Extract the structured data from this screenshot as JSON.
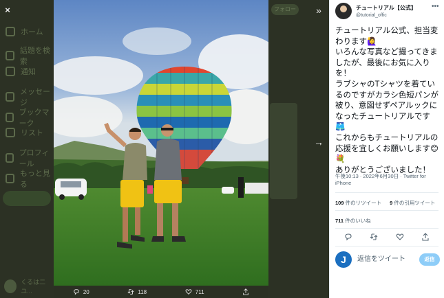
{
  "background": {
    "nav_items": [
      "ホーム",
      "話題を検索",
      "通知",
      "メッセージ",
      "ブックマーク",
      "リスト",
      "プロフィール",
      "もっと見る"
    ],
    "follow_label": "フォロー",
    "profile_name": "くるは二ユ..."
  },
  "viewer": {
    "close_icon": "×",
    "expand_icon": "»",
    "next_icon": "→",
    "photo_actions": [
      {
        "icon": "reply-icon",
        "count": "20"
      },
      {
        "icon": "retweet-icon",
        "count": "118"
      },
      {
        "icon": "like-icon",
        "count": "711"
      },
      {
        "icon": "share-icon",
        "count": ""
      }
    ]
  },
  "tweet": {
    "author_name": "チュートリアル【公式】",
    "author_handle": "@tutorial_offic",
    "more_icon": "•••",
    "text": "チュートリアル公式、担当変わります🙋‍♀️\nいろんな写真など撮ってきましたが、最後にお気に入りを！\nラブシャのTシャツを着ているのですがカラシ色短パンが被り、意図せずペアルックになったチュートリアルです🩳\nこれからもチュートリアルの応援を宜しくお願いします😊💐\nありがとうございました！",
    "timestamp": "午後10:13 · 2022年6月30日 · Twitter for iPhone",
    "retweets_count": "109",
    "retweets_label": "件のリツイート",
    "quotes_count": "9",
    "quotes_label": "件の引用ツイート",
    "likes_count": "711",
    "likes_label": "件のいいね"
  },
  "reply": {
    "avatar_letter": "J",
    "placeholder": "返信をツイート",
    "button_label": "返信"
  },
  "colors": {
    "accent": "#1d9bf0",
    "reply_button": "#8ecdf8"
  }
}
